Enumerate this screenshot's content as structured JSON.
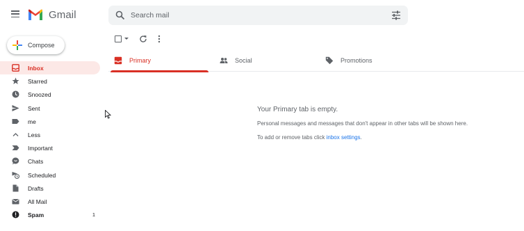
{
  "app": {
    "name": "Gmail",
    "logo_colors": [
      "#ea4335",
      "#4285f4",
      "#34a853",
      "#fbbc04",
      "#c5221f"
    ]
  },
  "search": {
    "placeholder": "Search mail",
    "value": ""
  },
  "compose": {
    "label": "Compose"
  },
  "sidebar": {
    "items": [
      {
        "label": "Inbox",
        "icon": "inbox-icon",
        "active": true,
        "count": ""
      },
      {
        "label": "Starred",
        "icon": "star-icon",
        "count": ""
      },
      {
        "label": "Snoozed",
        "icon": "clock-icon",
        "count": ""
      },
      {
        "label": "Sent",
        "icon": "send-icon",
        "count": ""
      },
      {
        "label": "me",
        "icon": "label-icon",
        "count": ""
      },
      {
        "label": "Less",
        "icon": "chevron-up-icon",
        "count": ""
      },
      {
        "label": "Important",
        "icon": "important-icon",
        "count": ""
      },
      {
        "label": "Chats",
        "icon": "chat-icon",
        "count": ""
      },
      {
        "label": "Scheduled",
        "icon": "scheduled-icon",
        "count": ""
      },
      {
        "label": "Drafts",
        "icon": "draft-icon",
        "count": ""
      },
      {
        "label": "All Mail",
        "icon": "mail-icon",
        "count": ""
      },
      {
        "label": "Spam",
        "icon": "spam-icon",
        "count": "1",
        "bold": true
      }
    ]
  },
  "tabs": [
    {
      "label": "Primary",
      "icon": "inbox-icon",
      "active": true
    },
    {
      "label": "Social",
      "icon": "people-icon"
    },
    {
      "label": "Promotions",
      "icon": "tag-icon"
    }
  ],
  "empty_state": {
    "title": "Your Primary tab is empty.",
    "description": "Personal messages and messages that don't appear in other tabs will be shown here.",
    "hint_prefix": "To add or remove tabs click ",
    "hint_link": "inbox settings",
    "hint_suffix": "."
  },
  "colors": {
    "accent": "#d93025",
    "active_bg": "#fce8e6",
    "link": "#1a73e8",
    "icon_gray": "#5f6368"
  }
}
